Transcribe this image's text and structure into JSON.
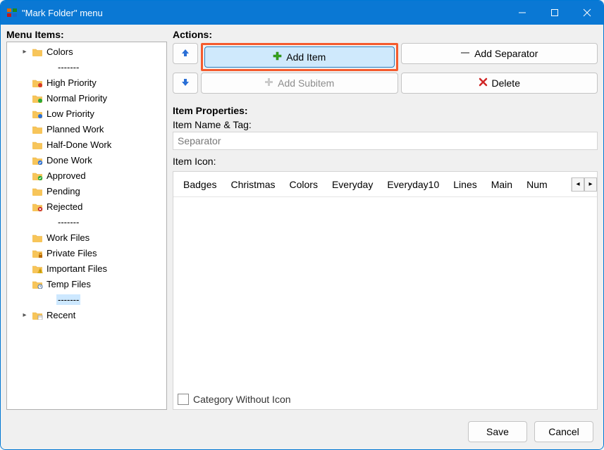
{
  "window": {
    "title": "\"Mark Folder\" menu"
  },
  "leftPane": {
    "heading": "Menu Items:",
    "items": [
      {
        "label": "Colors",
        "icon": "folder",
        "indent": 1,
        "expander": "▸",
        "selected": false
      },
      {
        "label": "-------",
        "icon": "none",
        "indent": 2,
        "expander": "",
        "selected": false
      },
      {
        "label": "High Priority",
        "icon": "folder-red",
        "indent": 1,
        "expander": "",
        "selected": false
      },
      {
        "label": "Normal Priority",
        "icon": "folder-green",
        "indent": 1,
        "expander": "",
        "selected": false
      },
      {
        "label": "Low Priority",
        "icon": "folder-blue",
        "indent": 1,
        "expander": "",
        "selected": false
      },
      {
        "label": "Planned Work",
        "icon": "folder",
        "indent": 1,
        "expander": "",
        "selected": false
      },
      {
        "label": "Half-Done Work",
        "icon": "folder",
        "indent": 1,
        "expander": "",
        "selected": false
      },
      {
        "label": "Done Work",
        "icon": "folder-check",
        "indent": 1,
        "expander": "",
        "selected": false
      },
      {
        "label": "Approved",
        "icon": "folder-approved",
        "indent": 1,
        "expander": "",
        "selected": false
      },
      {
        "label": "Pending",
        "icon": "folder",
        "indent": 1,
        "expander": "",
        "selected": false
      },
      {
        "label": "Rejected",
        "icon": "folder-rejected",
        "indent": 1,
        "expander": "",
        "selected": false
      },
      {
        "label": "-------",
        "icon": "none",
        "indent": 2,
        "expander": "",
        "selected": false
      },
      {
        "label": "Work Files",
        "icon": "folder",
        "indent": 1,
        "expander": "",
        "selected": false
      },
      {
        "label": "Private Files",
        "icon": "folder-lock",
        "indent": 1,
        "expander": "",
        "selected": false
      },
      {
        "label": "Important Files",
        "icon": "folder-warn",
        "indent": 1,
        "expander": "",
        "selected": false
      },
      {
        "label": "Temp Files",
        "icon": "folder-clock",
        "indent": 1,
        "expander": "",
        "selected": false
      },
      {
        "label": "-------",
        "icon": "none",
        "indent": 2,
        "expander": "",
        "selected": true
      },
      {
        "label": "Recent",
        "icon": "folder-recent",
        "indent": 1,
        "expander": "▸",
        "selected": false
      }
    ]
  },
  "actions": {
    "heading": "Actions:",
    "moveUp": "",
    "moveDown": "",
    "addItem": "Add Item",
    "addSeparator": "Add Separator",
    "addSubitem": "Add Subitem",
    "delete": "Delete"
  },
  "props": {
    "heading": "Item Properties:",
    "nameLabel": "Item Name & Tag:",
    "nameValue": "Separator",
    "iconLabel": "Item Icon:",
    "iconTabs": [
      "Badges",
      "Christmas",
      "Colors",
      "Everyday",
      "Everyday10",
      "Lines",
      "Main",
      "Num"
    ],
    "checkbox": "Category Without Icon"
  },
  "footer": {
    "save": "Save",
    "cancel": "Cancel"
  },
  "colors": {
    "folderBody": "#f7c55a",
    "folderTab": "#e9b03e"
  }
}
